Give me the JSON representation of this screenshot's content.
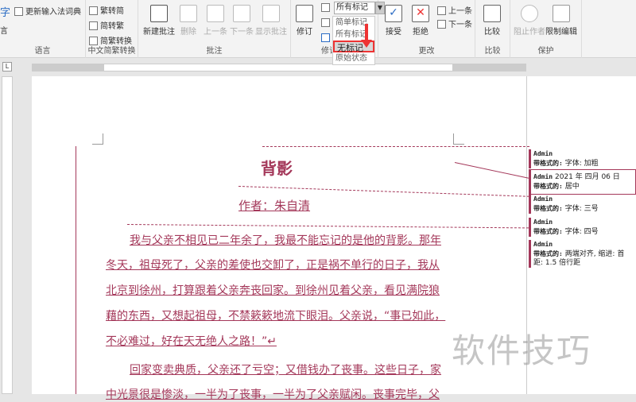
{
  "ribbon": {
    "language": {
      "partial_label": "字",
      "btn2": "言",
      "update_ime": "更新输入法词典",
      "group": "语言"
    },
    "chinese": {
      "t2s": "繁转简",
      "s2t": "简转繁",
      "convert": "简繁转换",
      "group": "中文简繁转换"
    },
    "comments": {
      "new": "新建批注",
      "delete": "删除",
      "prev": "上一条",
      "next": "下一条",
      "show": "显示批注",
      "group": "批注"
    },
    "tracking": {
      "track": "修订",
      "group": "修订",
      "dropdown_value": "所有标记",
      "menu": [
        "简单标记",
        "所有标记",
        "无标记",
        "原始状态"
      ],
      "selected": "无标记"
    },
    "changes": {
      "accept": "接受",
      "reject": "拒绝",
      "prev": "上一条",
      "next": "下一条",
      "group": "更改"
    },
    "compare": {
      "compare": "比较",
      "group": "比较"
    },
    "protect": {
      "block": "阻止作者",
      "restrict": "限制编辑",
      "group": "保护"
    }
  },
  "document": {
    "title": "背影",
    "author": "作者：朱自清",
    "lines": [
      "我与父亲不相见已二年余了，我最不能忘记的是他的背影。那年",
      "冬天，祖母死了，父亲的差使也交卸了，正是祸不单行的日子，我从",
      "北京到徐州，打算跟着父亲奔丧回家。到徐州见着父亲，看见满院狼",
      "藉的东西，又想起祖母，不禁簌簌地流下眼泪。父亲说，“事已如此，",
      "不必难过，好在天无绝人之路！”↵",
      "回家变卖典质，父亲还了亏空；又借钱办了丧事。这些日子，家",
      "中光景很是惨淡，一半为了丧事，一半为了父亲赋闲。丧事完毕，父"
    ]
  },
  "balloons": [
    {
      "author": "Admin",
      "date": "",
      "label": "带格式的:",
      "text": "字体: 加粗"
    },
    {
      "author": "Admin",
      "date": "2021 年 四月 06 日",
      "label": "带格式的:",
      "text": "居中"
    },
    {
      "author": "Admin",
      "date": "",
      "label": "带格式的:",
      "text": "字体: 三号"
    },
    {
      "author": "Admin",
      "date": "",
      "label": "带格式的:",
      "text": "字体: 四号"
    },
    {
      "author": "Admin",
      "date": "",
      "label": "带格式的:",
      "text": "两端对齐, 缩进: 首",
      "text2": "距: 1.5 倍行距"
    }
  ],
  "watermark": "软件技巧",
  "colors": {
    "revision": "#a4385a",
    "highlight": "#e33333"
  }
}
